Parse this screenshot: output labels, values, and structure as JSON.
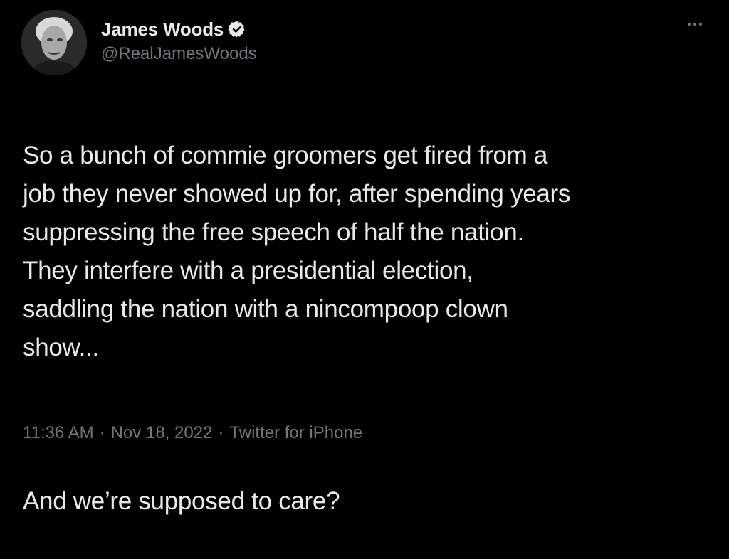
{
  "author": {
    "display_name": "James Woods",
    "handle": "@RealJamesWoods",
    "verified": true,
    "avatar_icon": "profile-photo",
    "verified_icon": "verified-badge-icon"
  },
  "menu": {
    "icon": "more-options-icon"
  },
  "tweet": {
    "paragraph_1": "So a bunch of commie groomers get fired from a\njob they never showed up for, after spending years\nsuppressing the free speech of half the nation.\nThey interfere with a presidential election,\nsaddling the nation with a nincompoop clown\nshow...",
    "paragraph_2": "And we’re supposed to care?"
  },
  "meta": {
    "time": "11:36 AM",
    "separator": "·",
    "date": "Nov 18, 2022",
    "source": "Twitter for iPhone"
  },
  "colors": {
    "background": "#000000",
    "primary_text": "#e7e9ea",
    "secondary_text": "#71767b"
  }
}
